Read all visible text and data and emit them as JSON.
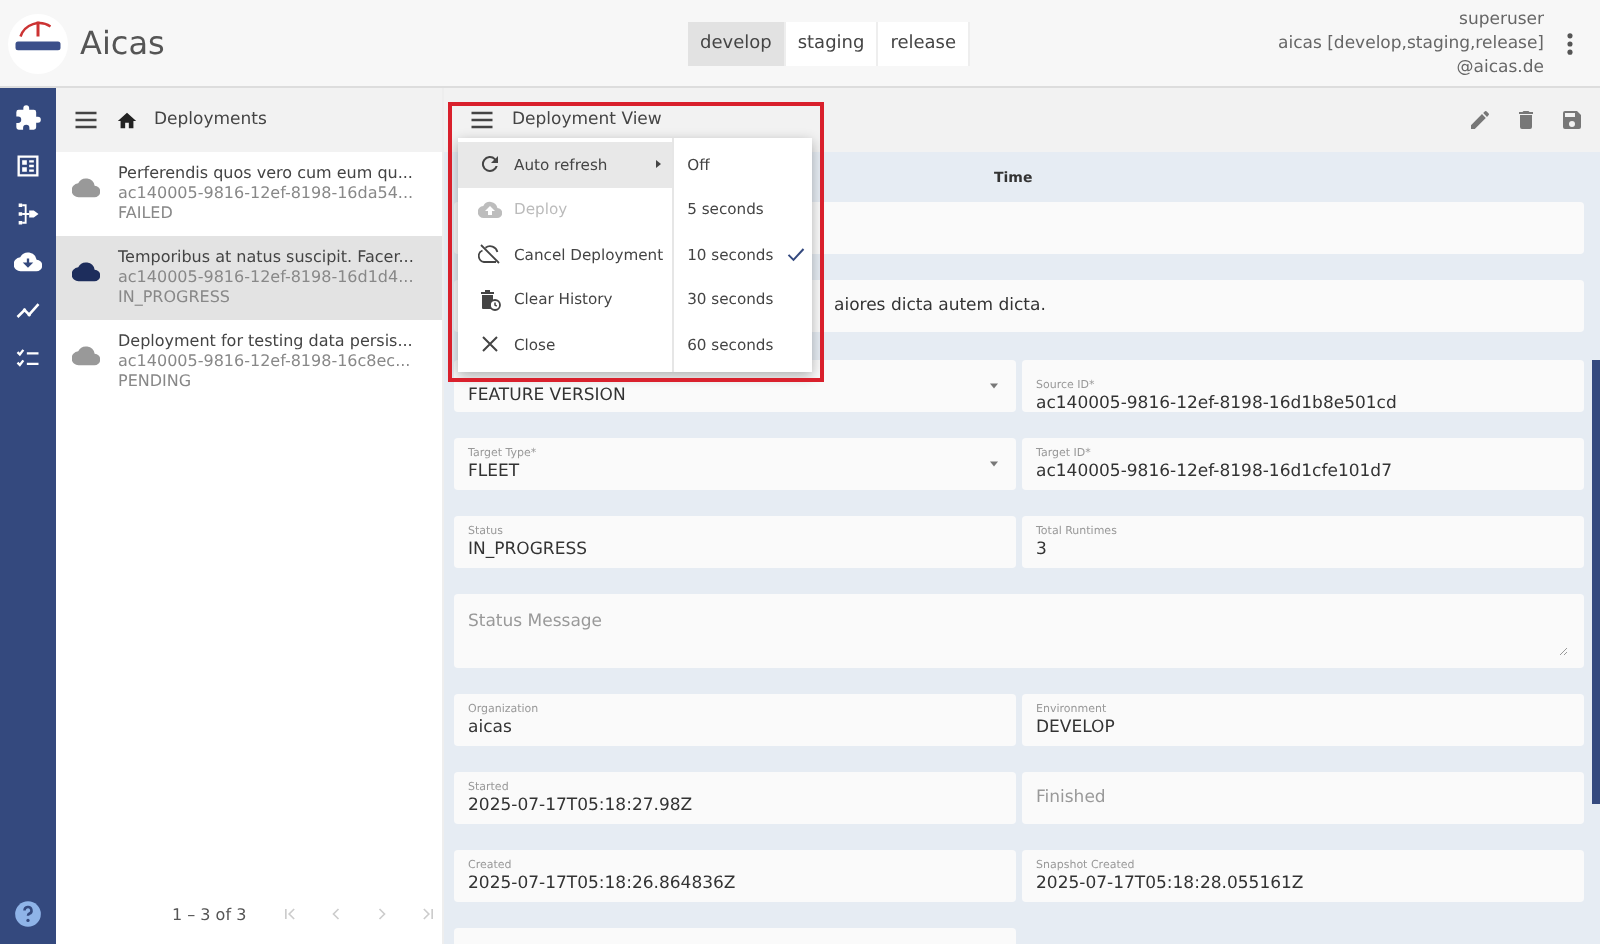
{
  "app": {
    "title": "Aicas"
  },
  "environments": [
    {
      "label": "develop",
      "selected": true
    },
    {
      "label": "staging",
      "selected": false
    },
    {
      "label": "release",
      "selected": false
    }
  ],
  "user": {
    "lines": [
      "superuser",
      "aicas [develop,staging,release]",
      "@aicas.de"
    ]
  },
  "nav": [
    {
      "kind": "puzzle"
    },
    {
      "kind": "dashboard"
    },
    {
      "kind": "flow"
    },
    {
      "kind": "cloud"
    },
    {
      "kind": "chart"
    },
    {
      "kind": "checklist"
    }
  ],
  "list": {
    "title": "Deployments",
    "items": [
      {
        "title": "Perferendis quos vero cum eum qu...",
        "id": "ac140005-9816-12ef-8198-16da54...",
        "status": "FAILED",
        "selected": false
      },
      {
        "title": "Temporibus at natus suscipit. Facer...",
        "id": "ac140005-9816-12ef-8198-16d1d4...",
        "status": "IN_PROGRESS",
        "selected": true
      },
      {
        "title": "Deployment for testing data persis...",
        "id": "ac140005-9816-12ef-8198-16c8ec...",
        "status": "PENDING",
        "selected": false
      }
    ],
    "paginator": "1 – 3 of 3"
  },
  "detail": {
    "title": "Deployment View",
    "column": "Time",
    "rows": [
      {
        "cells": [
          {
            "kind": "text"
          }
        ]
      },
      {
        "cells": [
          {
            "kind": "text",
            "value": "aiores dicta autem dicta."
          }
        ]
      },
      {
        "cells": [
          {
            "kind": "select",
            "value": "FEATURE VERSION"
          },
          {
            "kind": "text",
            "label": "Source ID*",
            "value": "ac140005-9816-12ef-8198-16d1b8e501cd"
          }
        ]
      },
      {
        "cells": [
          {
            "kind": "select",
            "label": "Target Type*",
            "value": "FLEET"
          },
          {
            "kind": "text",
            "label": "Target ID*",
            "value": "ac140005-9816-12ef-8198-16d1cfe101d7"
          }
        ]
      },
      {
        "cells": [
          {
            "kind": "text",
            "label": "Status",
            "value": "IN_PROGRESS"
          },
          {
            "kind": "text",
            "label": "Total Runtimes",
            "value": "3"
          }
        ]
      },
      {
        "cells": [
          {
            "kind": "textarea",
            "placeholder": "Status Message"
          }
        ]
      },
      {
        "cells": [
          {
            "kind": "text",
            "label": "Organization",
            "value": "aicas"
          },
          {
            "kind": "text",
            "label": "Environment",
            "value": "DEVELOP"
          }
        ]
      },
      {
        "cells": [
          {
            "kind": "text",
            "label": "Started",
            "value": "2025-07-17T05:18:27.98Z"
          },
          {
            "kind": "text",
            "placeholder": "Finished"
          }
        ]
      },
      {
        "cells": [
          {
            "kind": "text",
            "label": "Created",
            "value": "2025-07-17T05:18:26.864836Z"
          },
          {
            "kind": "text",
            "label": "Snapshot Created",
            "value": "2025-07-17T05:18:28.055161Z"
          }
        ]
      },
      {
        "cells": [
          {
            "kind": "text"
          },
          {
            "kind": "none"
          }
        ]
      }
    ]
  },
  "menu": {
    "items": [
      {
        "kind": "refresh",
        "label": "Auto refresh",
        "disabled": false,
        "highlighted": true,
        "submenu": true
      },
      {
        "kind": "upload",
        "label": "Deploy",
        "disabled": true,
        "highlighted": false,
        "submenu": false
      },
      {
        "kind": "cancel",
        "label": "Cancel Deployment",
        "disabled": false,
        "highlighted": false,
        "submenu": false
      },
      {
        "kind": "history",
        "label": "Clear History",
        "disabled": false,
        "highlighted": false,
        "submenu": false
      },
      {
        "kind": "close",
        "label": "Close",
        "disabled": false,
        "highlighted": false,
        "submenu": false
      }
    ],
    "submenu": [
      {
        "label": "Off",
        "checked": false
      },
      {
        "label": "5 seconds",
        "checked": false
      },
      {
        "label": "10 seconds",
        "checked": true
      },
      {
        "label": "30 seconds",
        "checked": false
      },
      {
        "label": "60 seconds",
        "checked": false
      }
    ]
  }
}
